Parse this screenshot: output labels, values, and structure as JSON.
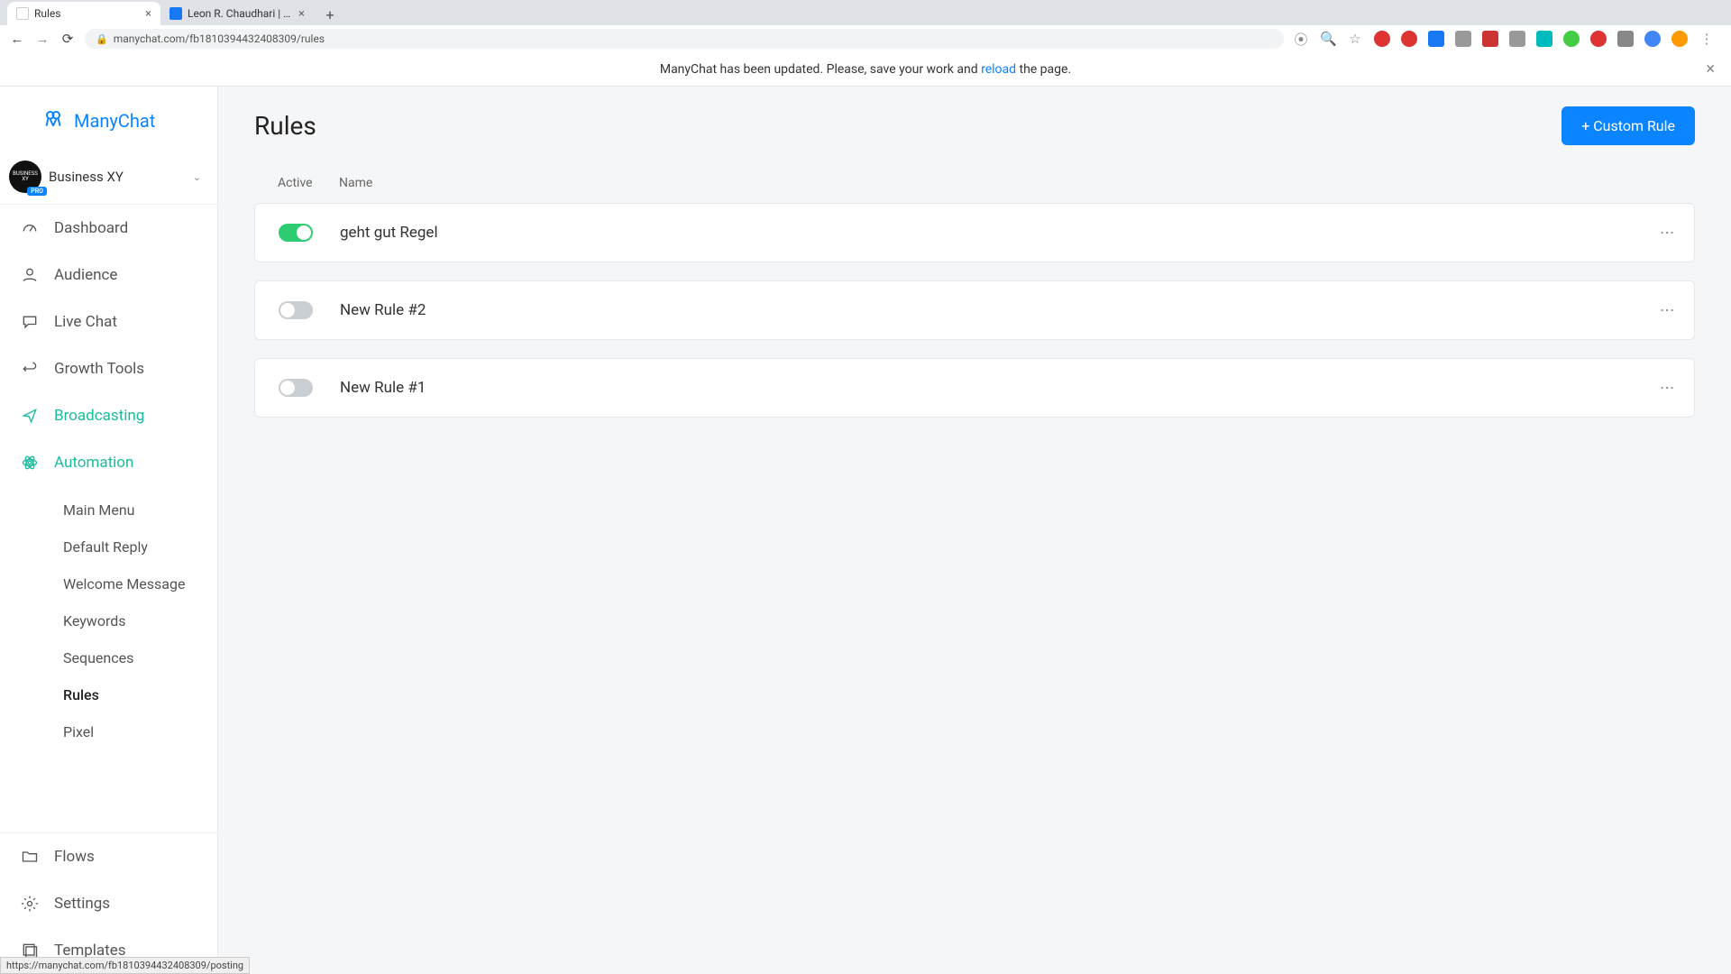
{
  "browser": {
    "tabs": [
      {
        "title": "Rules",
        "favicon_color": "#0a84ff",
        "favicon_text": ""
      },
      {
        "title": "Leon R. Chaudhari | Facebook",
        "favicon_color": "#1877f2",
        "favicon_text": ""
      }
    ],
    "url": "manychat.com/fb181039443240830­9/rules",
    "status_hint": "https://manychat.com/fb181039443240830­9/posting"
  },
  "notice": {
    "text_before": "ManyChat has been updated. Please, save your work and ",
    "link": "reload",
    "text_after": " the page."
  },
  "brand": {
    "name": "ManyChat"
  },
  "account": {
    "name": "Business XY",
    "badge": "PRO",
    "avatar_text": "BUSINESS XY"
  },
  "nav": {
    "dashboard": "Dashboard",
    "audience": "Audience",
    "livechat": "Live Chat",
    "growth": "Growth Tools",
    "broadcasting": "Broadcasting",
    "automation": "Automation",
    "flows": "Flows",
    "settings": "Settings",
    "templates": "Templates"
  },
  "automation_sub": {
    "main_menu": "Main Menu",
    "default_reply": "Default Reply",
    "welcome": "Welcome Message",
    "keywords": "Keywords",
    "sequences": "Sequences",
    "rules": "Rules",
    "pixel": "Pixel"
  },
  "page": {
    "title": "Rules",
    "create_btn": "+ Custom Rule",
    "col_active": "Active",
    "col_name": "Name"
  },
  "rules": [
    {
      "name": "geht gut Regel",
      "active": true
    },
    {
      "name": "New Rule #2",
      "active": false
    },
    {
      "name": "New Rule #1",
      "active": false
    }
  ]
}
